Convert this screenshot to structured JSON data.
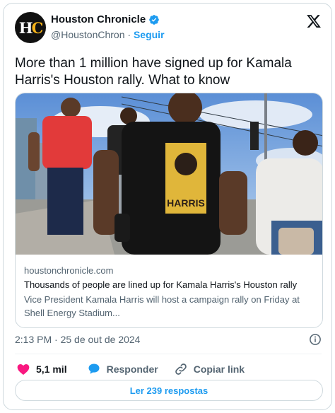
{
  "author": {
    "avatar_text": "HC",
    "name": "Houston Chronicle",
    "handle": "@HoustonChron",
    "separator": "·",
    "follow_label": "Seguir"
  },
  "tweet": {
    "text": "More than 1 million have signed up for Kamala Harris's Houston rally. What to know",
    "timestamp": "2:13 PM · 25 de out de 2024"
  },
  "link_card": {
    "domain": "houstonchronicle.com",
    "title": "Thousands of people are lined up for Kamala Harris's Houston rally",
    "description": "Vice President Kamala Harris will host a campaign rally on Friday at Shell Energy Stadium...",
    "shirt_text": "HARRIS"
  },
  "actions": {
    "likes": "5,1 mil",
    "reply_label": "Responder",
    "copy_label": "Copiar link"
  },
  "replies_button": "Ler 239 respostas",
  "icons": {
    "verified": "verified-badge-icon",
    "platform": "x-logo-icon",
    "info": "info-icon",
    "like": "heart-icon",
    "reply": "speech-bubble-icon",
    "copy": "link-icon"
  },
  "colors": {
    "accent": "#1d9bf0",
    "heart": "#f91880",
    "secondary_text": "#536471",
    "border": "#cfd9de"
  }
}
